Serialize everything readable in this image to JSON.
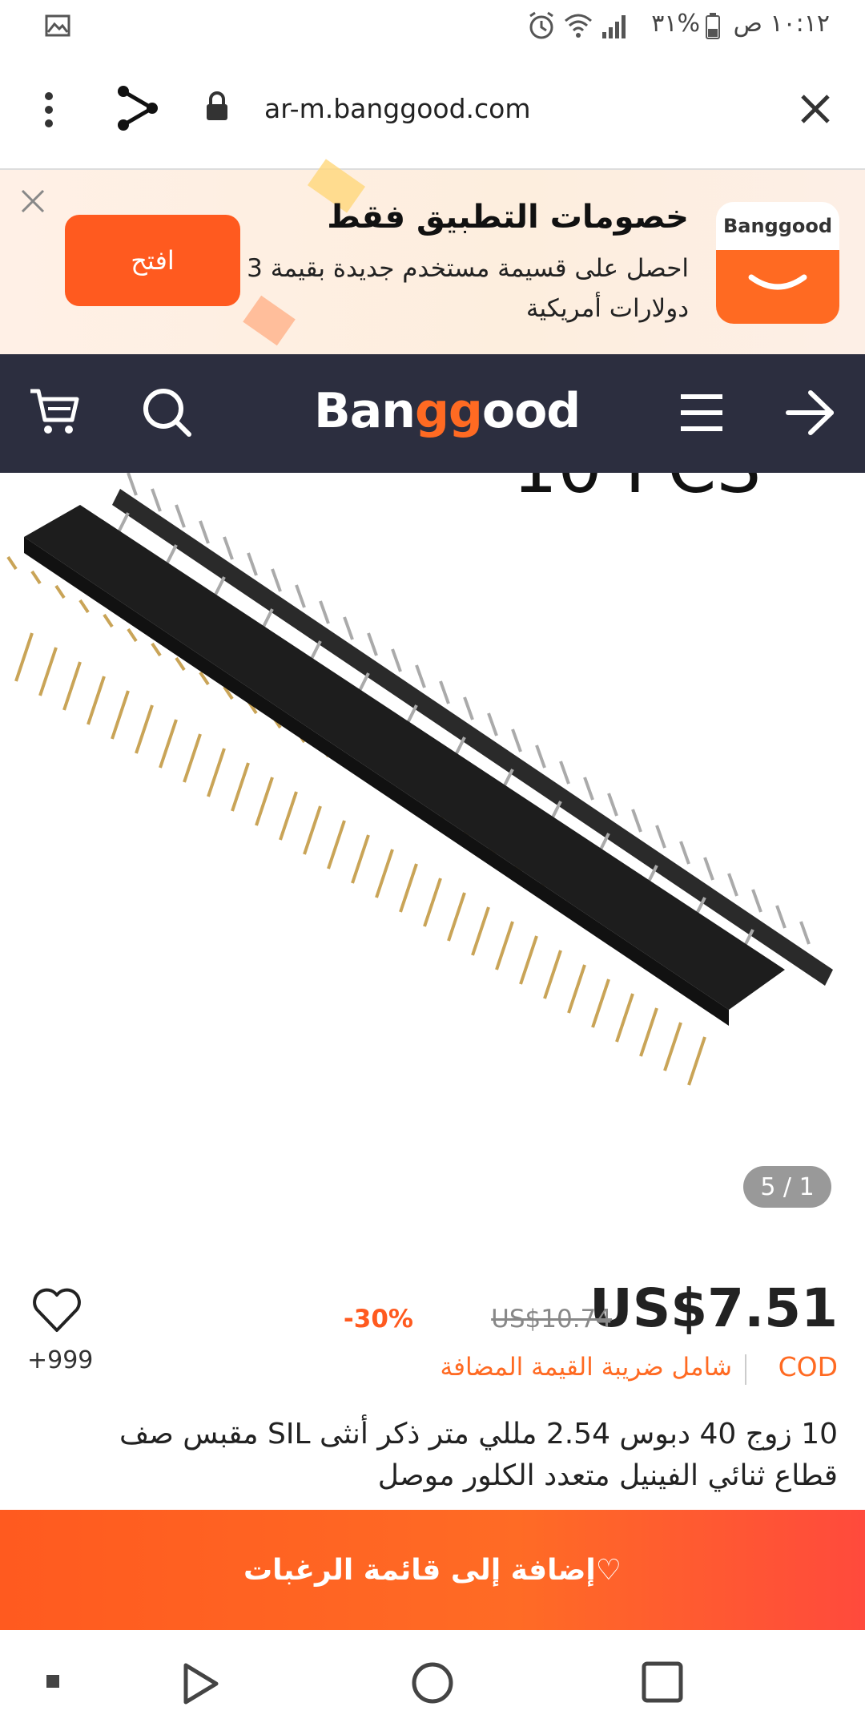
{
  "status_bar": {
    "time": "١٠:١٢ ص",
    "battery": "%٣١",
    "icons": [
      "image-icon",
      "alarm-icon",
      "wifi-icon",
      "signal-icon",
      "battery-icon"
    ]
  },
  "browser": {
    "url": "ar-m.banggood.com",
    "icons": [
      "menu-dots-icon",
      "share-icon",
      "lock-icon",
      "close-icon"
    ]
  },
  "promo": {
    "title": "خصومات التطبيق فقط",
    "subtitle": "احصل على قسيمة مستخدم جديدة بقيمة 3 دولارات أمريكية",
    "open_label": "افتح",
    "logo_text": "Banggood"
  },
  "nav": {
    "brand": "Banggood",
    "brand_accent": "#ff6a22",
    "icons": [
      "cart-icon",
      "search-icon",
      "hamburger-icon",
      "arrow-forward-icon"
    ]
  },
  "gallery": {
    "counter": "5 / 1",
    "overlay_text": "10 PCS"
  },
  "product": {
    "price": "US$7.51",
    "old_price": "US$10.74",
    "discount": "30%-",
    "cod": "COD",
    "tax_note": "شامل ضريبة القيمة المضافة",
    "wishlist_count": "+999",
    "title": "10 زوج 40 دبوس 2.54 مللي متر ذكر أنثى SIL مقبس صف قطاع ثنائي الفينيل متعدد الكلور موصل"
  },
  "cta": {
    "label": "♡إضافة إلى قائمة الرغبات"
  },
  "colors": {
    "accent": "#ff5a1f",
    "navbar": "#2c2e3f"
  }
}
